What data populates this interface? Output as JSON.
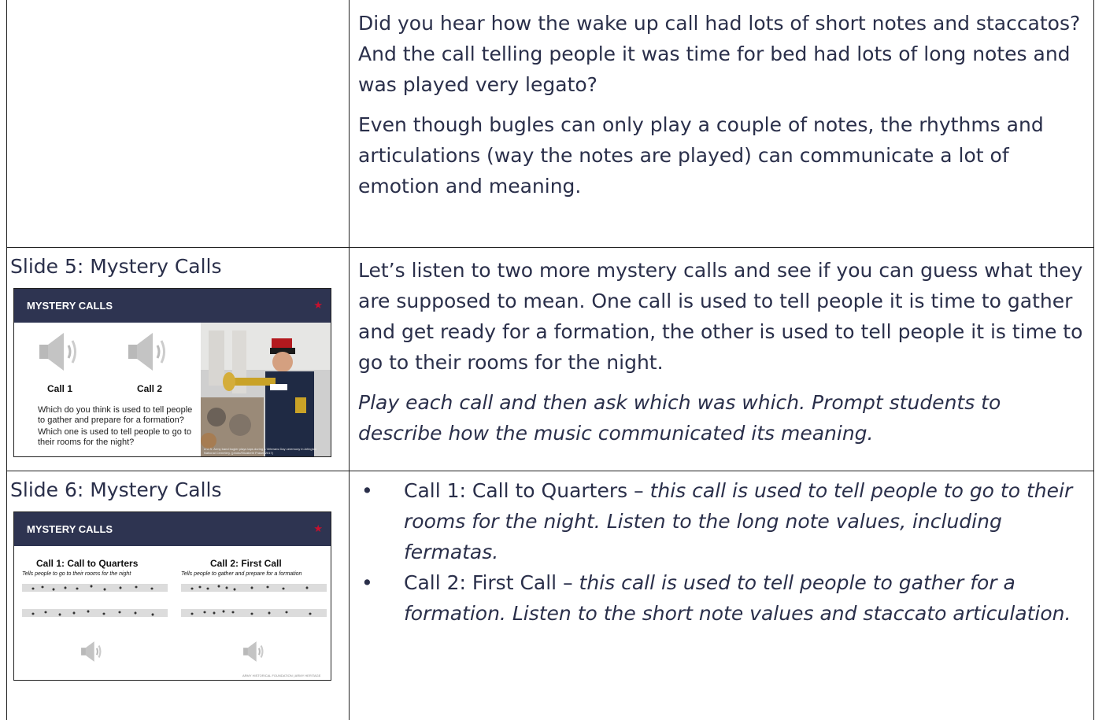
{
  "row1": {
    "para1": "Did you hear how the wake up call had lots of short notes and staccatos? And the call telling people it was time for bed had lots of long notes and was played very legato?",
    "para2": "Even though bugles can only play a couple of notes, the rhythms and articulations (way the notes are played) can communicate a lot of emotion and meaning."
  },
  "row2": {
    "slide_title": "Slide 5: Mystery Calls",
    "slide": {
      "header": "MYSTERY CALLS",
      "star": "★",
      "call1": "Call 1",
      "call2": "Call 2",
      "question1": "Which do you think is used to tell people to gather and prepare for a formation?",
      "question2": "Which one is used to tell people to go to their rooms for the night?",
      "caption": "A U.S. Army band bugler plays taps during a Veterans Day ceremony in Arlington National Cemetery. (photo/Elizabeth Fraser/2017)"
    },
    "para1": "Let’s listen to two more mystery calls and see if you can guess what they are supposed to mean. One call is used to tell people it is time to gather and get ready for a formation, the other is used to tell people it is time to go to their rooms for the night.",
    "para2": "Play each call and then ask which was which. Prompt students to describe how the music communicated its meaning."
  },
  "row3": {
    "slide_title": "Slide 6: Mystery Calls",
    "slide": {
      "header": "MYSTERY CALLS",
      "star": "★",
      "call1_title": "Call 1: Call to Quarters",
      "call1_sub": "Tells people to go to their rooms for the night",
      "call2_title": "Call 2: First Call",
      "call2_sub": "Tells people to gather and prepare for a formation",
      "footer": "ARMY HISTORICAL FOUNDATION | ARMY HERITAGE"
    },
    "bullet1_plain": "Call 1: Call to Quarters – ",
    "bullet1_italic": "this call is used to tell people to go to their rooms for the night. Listen to the long note values, including fermatas.",
    "bullet2_plain": "Call 2: First Call – ",
    "bullet2_italic": "this call is used to tell people to gather for a formation. Listen to the short note values and staccato articulation.",
    "bullet_symbol": "•"
  },
  "colors": {
    "header": "#2e3451",
    "star": "#c8102e",
    "text": "#2a2f4a"
  }
}
